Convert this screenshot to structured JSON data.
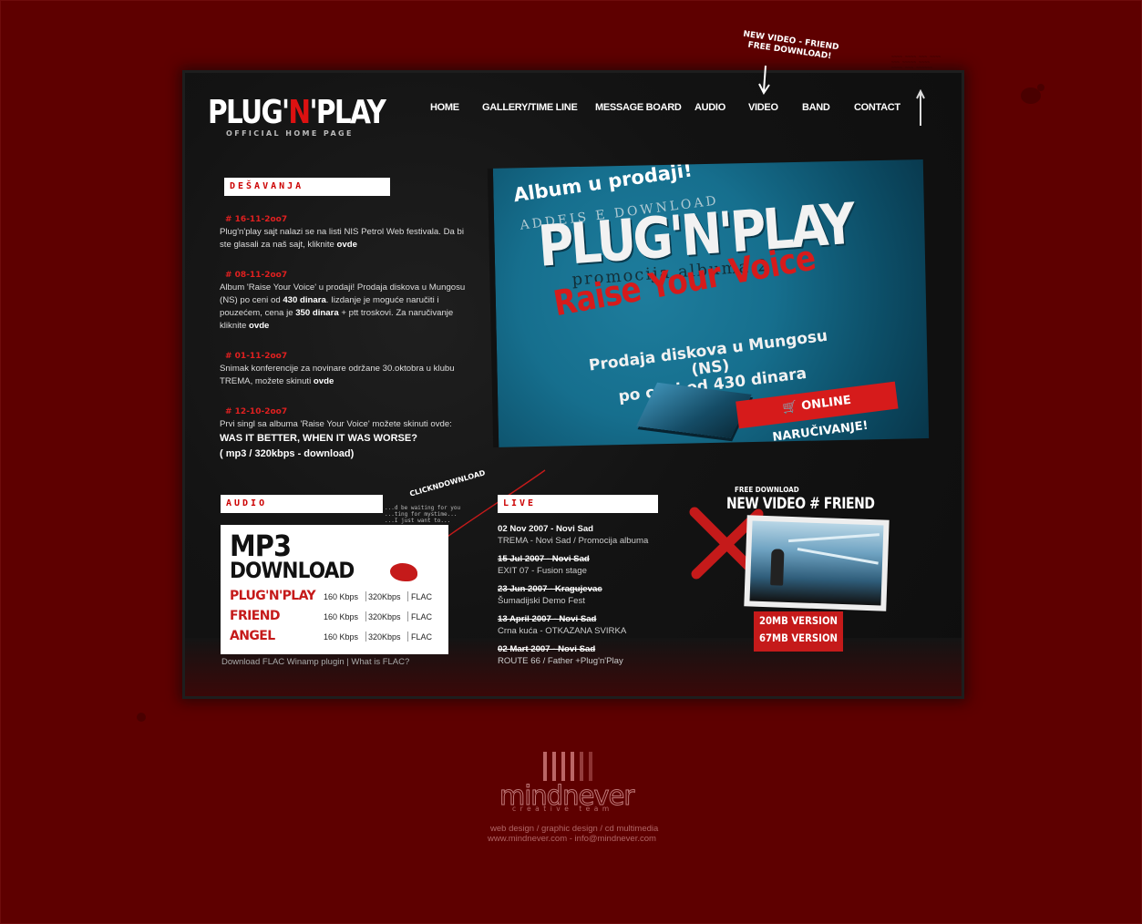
{
  "top_note": {
    "line1": "NEW VIDEO - FRIEND",
    "line2": "FREE DOWNLOAD!"
  },
  "logo": {
    "part1": "PLUG'",
    "part_n": "N",
    "part2": "'PLAY",
    "subtitle": "OFFICIAL HOME PAGE"
  },
  "nav": [
    "HOME",
    "GALLERY/TIME LINE",
    "MESSAGE BOARD",
    "AUDIO",
    "VIDEO",
    "BAND",
    "CONTACT"
  ],
  "desavanja": {
    "header": "DEŠAVANJA",
    "items": [
      {
        "date": "# 16-11-2oo7",
        "text": "Plug'n'play sajt nalazi se na listi NIS Petrol Web festivala. Da bi ste glasali za naš sajt, kliknite ",
        "link": "ovde"
      },
      {
        "date": "# 08-11-2oo7",
        "text_a": "Album 'Raise Your Voice' u prodaji! Prodaja diskova u Mungosu (NS) po ceni od ",
        "bold_a": "430 dinara",
        "text_b": ". Iizdanje je moguće naručiti i pouzećem, cena je ",
        "bold_b": "350 dinara",
        "text_c": " + ptt troskovi. Za naručivanje kliknite ",
        "link": "ovde"
      },
      {
        "date": "# 01-11-2oo7",
        "text": "Snimak konferencije za novinare održane 30.oktobra u klubu TREMA, možete skinuti ",
        "link": "ovde"
      },
      {
        "date": "# 12-10-2oo7",
        "text": "Prvi singl sa albuma 'Raise Your Voice' možete skinuti ovde:"
      }
    ],
    "single_title": "WAS IT BETTER, WHEN IT WAS WORSE?",
    "single_download": "( mp3 / 320kbps - download)"
  },
  "banner": {
    "headline": "Album u prodaji!",
    "ghost1": "ADDEIS E DOWNLOAD",
    "title": "PLUG'N'PLAY",
    "ghost2": "promocija albuma 2",
    "album": "Raise Your Voice",
    "sale_line1": "Prodaja diskova u Mungosu (NS)",
    "sale_line2": "po ceni od 430 dinara",
    "order_button": "ONLINE NARUČIVANJE!"
  },
  "audio": {
    "header": "AUDIO",
    "title_line1": "MP3",
    "title_line2": "DOWNLOAD",
    "rows": [
      {
        "song": "PLUG'N'PLAY",
        "f1": "160 Kbps",
        "f2": "320Kbps",
        "f3": "FLAC"
      },
      {
        "song": "FRIEND",
        "f1": "160 Kbps",
        "f2": "320Kbps",
        "f3": "FLAC"
      },
      {
        "song": "ANGEL",
        "f1": "160 Kbps",
        "f2": "320Kbps",
        "f3": "FLAC"
      }
    ],
    "flac_plugin": "Download FLAC Winamp plugin",
    "flac_sep": "|",
    "flac_what": "What is FLAC?",
    "click_note": "CLICKNDOWNLOAD",
    "handwritten": [
      "...d be waiting for you",
      "...ting for mystime...",
      "...I just want to..."
    ]
  },
  "live": {
    "header": "LIVE",
    "items": [
      {
        "date": "02 Nov 2007 - Novi Sad",
        "desc": "TREMA - Novi Sad / Promocija albuma",
        "past": false
      },
      {
        "date": "15 Jul 2007 - Novi Sad",
        "desc": "EXIT 07 - Fusion stage",
        "past": true
      },
      {
        "date": "23 Jun 2007 - Kragujevac",
        "desc": "Šumadijski Demo Fest",
        "past": true
      },
      {
        "date": "13 April 2007 - Novi Sad",
        "desc": "Crna kuća - OTKAZANA SVIRKA",
        "past": true
      },
      {
        "date": "02 Mart 2007 - Novi Sad",
        "desc": "ROUTE 66 / Father +Plug'n'Play",
        "past": true
      }
    ]
  },
  "video": {
    "free_label": "FREE DOWNLOAD",
    "title": "NEW VIDEO # FRIEND",
    "version_20": "20MB VERSION",
    "version_67": "67MB VERSION"
  },
  "footer": {
    "brand": "mindnever",
    "tagline": "creative team",
    "services": "web design / graphic design / cd multimedia",
    "contact": "www.mindnever.com - info@mindnever.com"
  },
  "colors": {
    "background": "#5e0000",
    "panel": "#141414",
    "accent_red": "#c51a1a",
    "banner_blue": "#166f8e"
  }
}
